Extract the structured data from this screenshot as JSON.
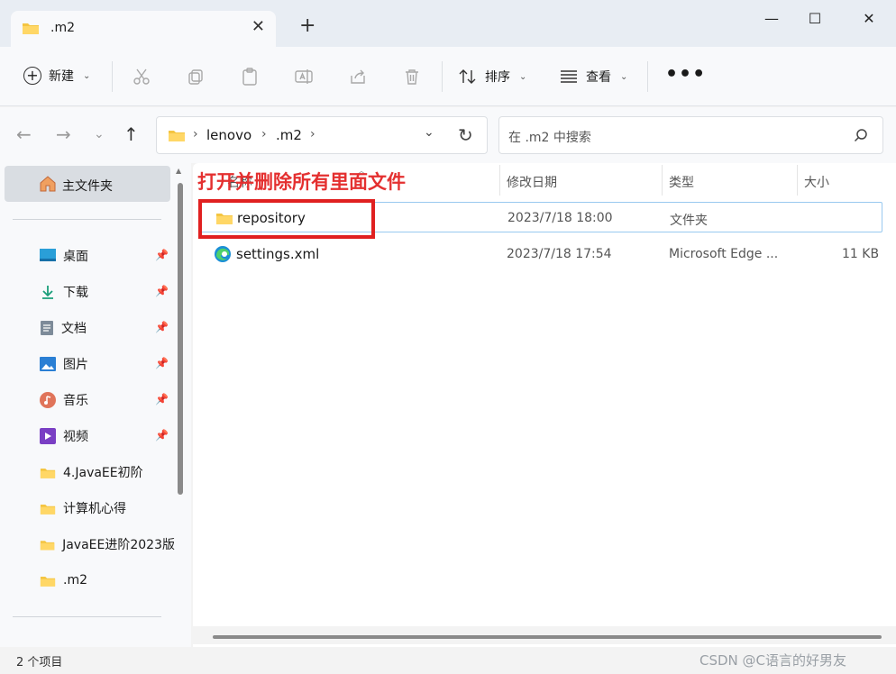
{
  "tab": {
    "title": ".m2",
    "close": "✕",
    "new": "+"
  },
  "window": {
    "minimize": "—",
    "maximize": "☐",
    "close": "✕"
  },
  "toolbar": {
    "new_label": "新建",
    "sort_label": "排序",
    "view_label": "查看",
    "more": "•••"
  },
  "address": {
    "segments": [
      "lenovo",
      ".m2"
    ]
  },
  "search": {
    "placeholder": "在 .m2 中搜索"
  },
  "sidebar": {
    "home": "主文件夹",
    "quick_access": [
      {
        "label": "桌面",
        "icon": "desktop-icon",
        "pinned": true
      },
      {
        "label": "下载",
        "icon": "download-icon",
        "pinned": true
      },
      {
        "label": "文档",
        "icon": "document-icon",
        "pinned": true
      },
      {
        "label": "图片",
        "icon": "picture-icon",
        "pinned": true
      },
      {
        "label": "音乐",
        "icon": "music-icon",
        "pinned": true
      },
      {
        "label": "视频",
        "icon": "video-icon",
        "pinned": true
      }
    ],
    "folders": [
      {
        "label": "4.JavaEE初阶"
      },
      {
        "label": "计算机心得"
      },
      {
        "label": "JavaEE进阶2023版"
      },
      {
        "label": ".m2"
      }
    ]
  },
  "columns": {
    "name": "名称",
    "date": "修改日期",
    "type": "类型",
    "size": "大小"
  },
  "files": [
    {
      "name": "repository",
      "date": "2023/7/18 18:00",
      "type": "文件夹",
      "size": "",
      "icon": "folder-icon"
    },
    {
      "name": "settings.xml",
      "date": "2023/7/18 17:54",
      "type": "Microsoft Edge ...",
      "size": "11 KB",
      "icon": "edge-icon"
    }
  ],
  "annotation": {
    "text": "打开并删除所有里面文件",
    "color": "#e02020"
  },
  "status": {
    "count": "2 个项目"
  },
  "watermark": "CSDN @C语言的好男友"
}
